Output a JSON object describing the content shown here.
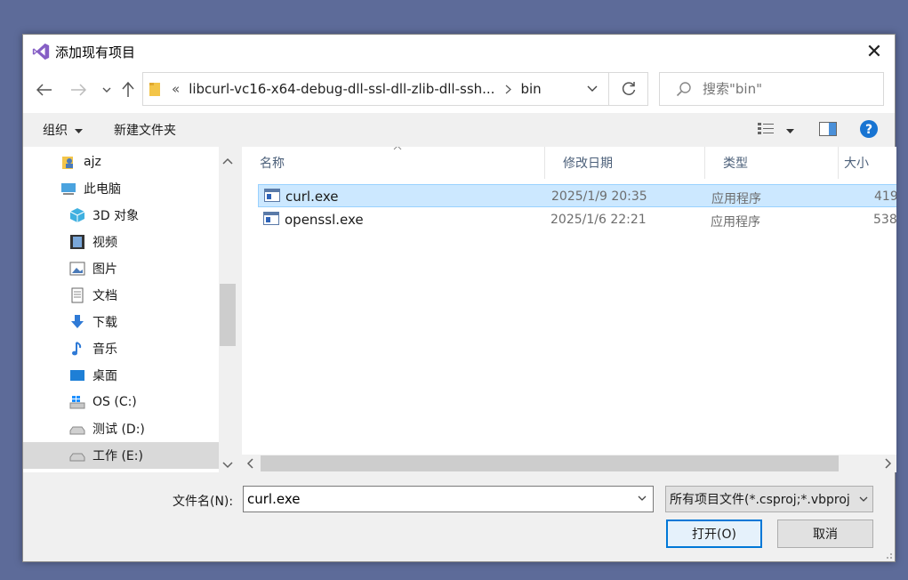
{
  "dialog": {
    "title": "添加现有项目",
    "close_glyph": "✕"
  },
  "nav": {
    "address_prefix": "«",
    "breadcrumb_path": "libcurl-vc16-x64-debug-dll-ssl-dll-zlib-dll-ssh...",
    "breadcrumb_current": "bin",
    "search_placeholder": "搜索\"bin\""
  },
  "toolbar": {
    "organize": "组织",
    "new_folder": "新建文件夹"
  },
  "sidebar": {
    "items": [
      {
        "label": "ajz",
        "icon": "user-folder-icon"
      },
      {
        "label": "此电脑",
        "icon": "computer-icon"
      },
      {
        "label": "3D 对象",
        "icon": "3d-objects-icon"
      },
      {
        "label": "视频",
        "icon": "video-icon"
      },
      {
        "label": "图片",
        "icon": "pictures-icon"
      },
      {
        "label": "文档",
        "icon": "documents-icon"
      },
      {
        "label": "下载",
        "icon": "download-icon"
      },
      {
        "label": "音乐",
        "icon": "music-icon"
      },
      {
        "label": "桌面",
        "icon": "desktop-icon"
      },
      {
        "label": "OS (C:)",
        "icon": "windows-drive-icon"
      },
      {
        "label": "测试 (D:)",
        "icon": "drive-icon"
      },
      {
        "label": "工作 (E:)",
        "icon": "drive-icon"
      }
    ]
  },
  "columns": {
    "name": "名称",
    "modified": "修改日期",
    "type": "类型",
    "size": "大小"
  },
  "files": [
    {
      "name": "curl.exe",
      "modified": "2025/1/9 20:35",
      "type": "应用程序",
      "size": "419"
    },
    {
      "name": "openssl.exe",
      "modified": "2025/1/6 22:21",
      "type": "应用程序",
      "size": "538"
    }
  ],
  "footer": {
    "filename_label": "文件名(N):",
    "filename_value": "curl.exe",
    "filetype_value": "所有项目文件(*.csproj;*.vbproj",
    "open_button": "打开(O)",
    "cancel_button": "取消"
  },
  "colors": {
    "accent": "#0078d7",
    "selection": "#cce8ff",
    "vs_purple": "#865fc5"
  }
}
